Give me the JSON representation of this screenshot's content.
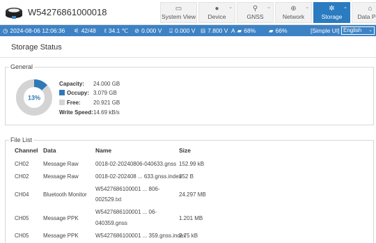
{
  "header": {
    "device_id": "W54276861000018",
    "nav": [
      {
        "label": "System View",
        "icon": "monitor-icon",
        "active": false
      },
      {
        "label": "Device",
        "icon": "satellite-device-icon",
        "active": false
      },
      {
        "label": "GNSS",
        "icon": "location-pin-icon",
        "active": false
      },
      {
        "label": "Network",
        "icon": "globe-icon",
        "active": false
      },
      {
        "label": "Storage",
        "icon": "storage-icon",
        "active": true
      },
      {
        "label": "Data Port",
        "icon": "data-port-icon",
        "active": false
      }
    ]
  },
  "statusbar": {
    "datetime": "2024-08-06 12:06:36",
    "satellites": "42/48",
    "temperature": "34.1 ℃",
    "voltage1": "0.000 V",
    "voltage2": "0.000 V",
    "voltage3": "7.800 V",
    "battery_a_label": "A",
    "battery_a": "68%",
    "battery_b": "66%",
    "mode": "[Simple UI]",
    "language": "English"
  },
  "page": {
    "title": "Storage Status"
  },
  "general": {
    "legend": "General",
    "percent_label": "13%",
    "used_fraction": 0.13,
    "colors": {
      "occupied": "#2f79b8",
      "free": "#d4d4d4"
    },
    "rows": [
      {
        "label": "Capacity:",
        "value": "24.000 GB"
      },
      {
        "label": "Occupy:",
        "value": "3.079 GB"
      },
      {
        "label": "Free:",
        "value": "20.921 GB"
      },
      {
        "label": "Write Speed:",
        "value": "14.69 kB/s"
      }
    ]
  },
  "file_list": {
    "legend": "File List",
    "columns": [
      "Channel",
      "Data",
      "Name",
      "Size"
    ],
    "rows": [
      {
        "channel": "CH02",
        "data": "Message Raw",
        "name": [
          "0018-02-20240806-040633.gnss"
        ],
        "size": "152.99 kB"
      },
      {
        "channel": "CH02",
        "data": "Message Raw",
        "name": [
          "0018-02-202408 ... 633.gnss.index"
        ],
        "size": "352 B"
      },
      {
        "channel": "CH04",
        "data": "Bluetooth Monitor",
        "name": [
          "W5427686100001 ... 806-",
          "002529.txt"
        ],
        "size": "24.297 MB"
      },
      {
        "channel": "CH05",
        "data": "Message PPK",
        "name": [
          "W5427686100001 ... 06-",
          "040359.gnss"
        ],
        "size": "1.201 MB"
      },
      {
        "channel": "CH05",
        "data": "Message PPK",
        "name": [
          "W5427686100001 ... 359.gnss.index"
        ],
        "size": "2.75 kB"
      }
    ]
  }
}
